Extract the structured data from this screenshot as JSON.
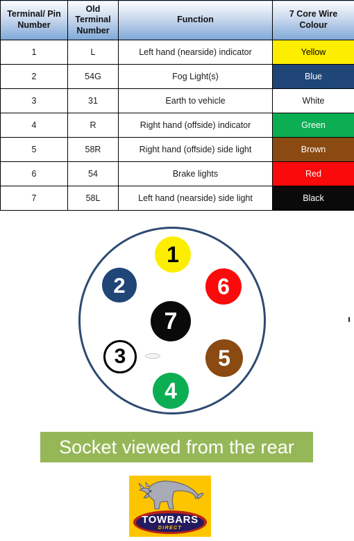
{
  "table": {
    "headers": [
      "Terminal/ Pin Number",
      "Old Terminal Number",
      "Function",
      "7 Core Wire Colour"
    ],
    "rows": [
      {
        "pin": "1",
        "old_terminal": "L",
        "function": "Left hand (nearside) indicator",
        "colour": "Yellow",
        "swatch": "#fdee00",
        "text_colour": "#000000"
      },
      {
        "pin": "2",
        "old_terminal": "54G",
        "function": "Fog Light(s)",
        "colour": "Blue",
        "swatch": "#1f4677",
        "text_colour": "#ffffff"
      },
      {
        "pin": "3",
        "old_terminal": "31",
        "function": "Earth to vehicle",
        "colour": "White",
        "swatch": "#ffffff",
        "text_colour": "#1a1a1a"
      },
      {
        "pin": "4",
        "old_terminal": "R",
        "function": "Right hand (offside) indicator",
        "colour": "Green",
        "swatch": "#0cae54",
        "text_colour": "#ffffff"
      },
      {
        "pin": "5",
        "old_terminal": "58R",
        "function": "Right hand (offside) side light",
        "colour": "Brown",
        "swatch": "#8a4a12",
        "text_colour": "#ffffff"
      },
      {
        "pin": "6",
        "old_terminal": "54",
        "function": "Brake lights",
        "colour": "Red",
        "swatch": "#fa0a0a",
        "text_colour": "#ffffff"
      },
      {
        "pin": "7",
        "old_terminal": "58L",
        "function": "Left hand (nearside) side light",
        "colour": "Black",
        "swatch": "#0a0a0a",
        "text_colour": "#ffffff"
      }
    ]
  },
  "socket": {
    "outline_colour": "#2e4a72",
    "pins": [
      {
        "number": "1",
        "colour": "#fdee00",
        "label_colour": "#000000"
      },
      {
        "number": "2",
        "colour": "#1f4677",
        "label_colour": "#ffffff"
      },
      {
        "number": "3",
        "colour": "#ffffff",
        "label_colour": "#000000"
      },
      {
        "number": "4",
        "colour": "#0cae54",
        "label_colour": "#ffffff"
      },
      {
        "number": "5",
        "colour": "#8a4a12",
        "label_colour": "#ffffff"
      },
      {
        "number": "6",
        "colour": "#fa0a0a",
        "label_colour": "#ffffff"
      },
      {
        "number": "7",
        "colour": "#0a0a0a",
        "label_colour": "#ffffff"
      }
    ]
  },
  "caption": {
    "text": "Socket viewed from the rear",
    "background": "#96b758",
    "text_colour": "#ffffff"
  },
  "logo": {
    "primary_text": "TOWBARS",
    "secondary_text": "DIRECT",
    "background": "#fdc500",
    "badge_outer": "#b92216",
    "badge_inner": "#241b5e"
  }
}
